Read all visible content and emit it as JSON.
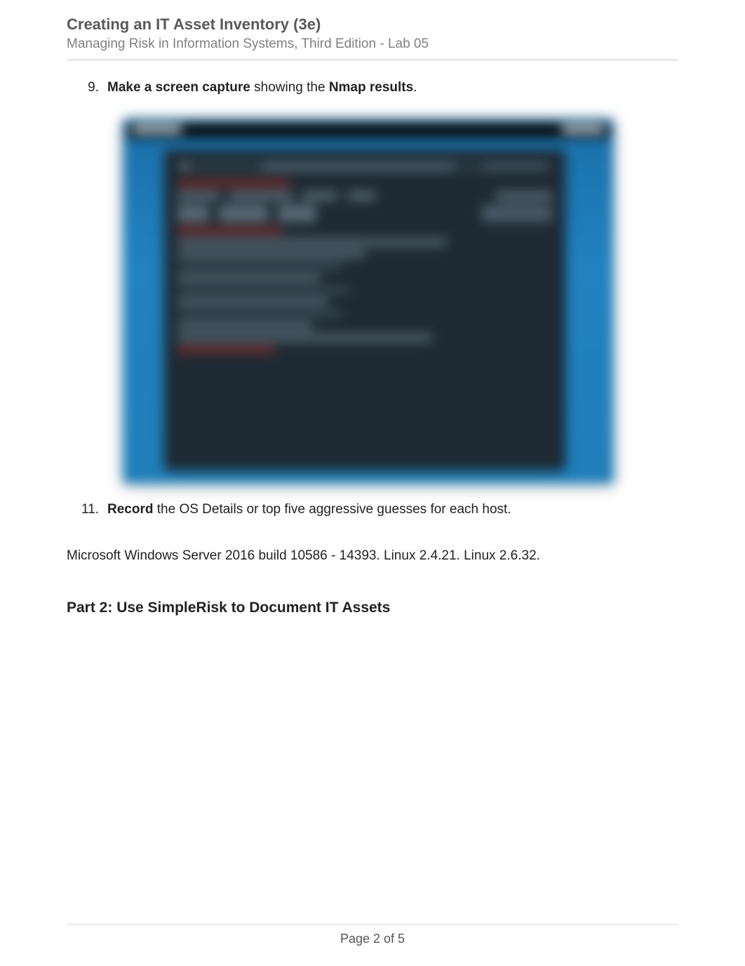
{
  "header": {
    "title": "Creating an IT Asset Inventory (3e)",
    "subtitle": "Managing Risk in Information Systems, Third Edition - Lab 05"
  },
  "items": [
    {
      "num": "9.",
      "bold1": "Make a screen capture",
      "mid": " showing the ",
      "bold2": "Nmap results",
      "tail": "."
    },
    {
      "num": "11.",
      "bold1": "Record",
      "mid": " the OS Details or top five aggressive guesses for each host.",
      "bold2": "",
      "tail": ""
    }
  ],
  "answer": "Microsoft Windows Server 2016 build 10586 - 14393. Linux 2.4.21. Linux 2.6.32.",
  "part2": "Part 2: Use SimpleRisk to Document IT Assets",
  "footer": {
    "page": "Page 2 of 5"
  },
  "screenshot": {
    "description": "Blurred Nmap terminal output screenshot"
  }
}
